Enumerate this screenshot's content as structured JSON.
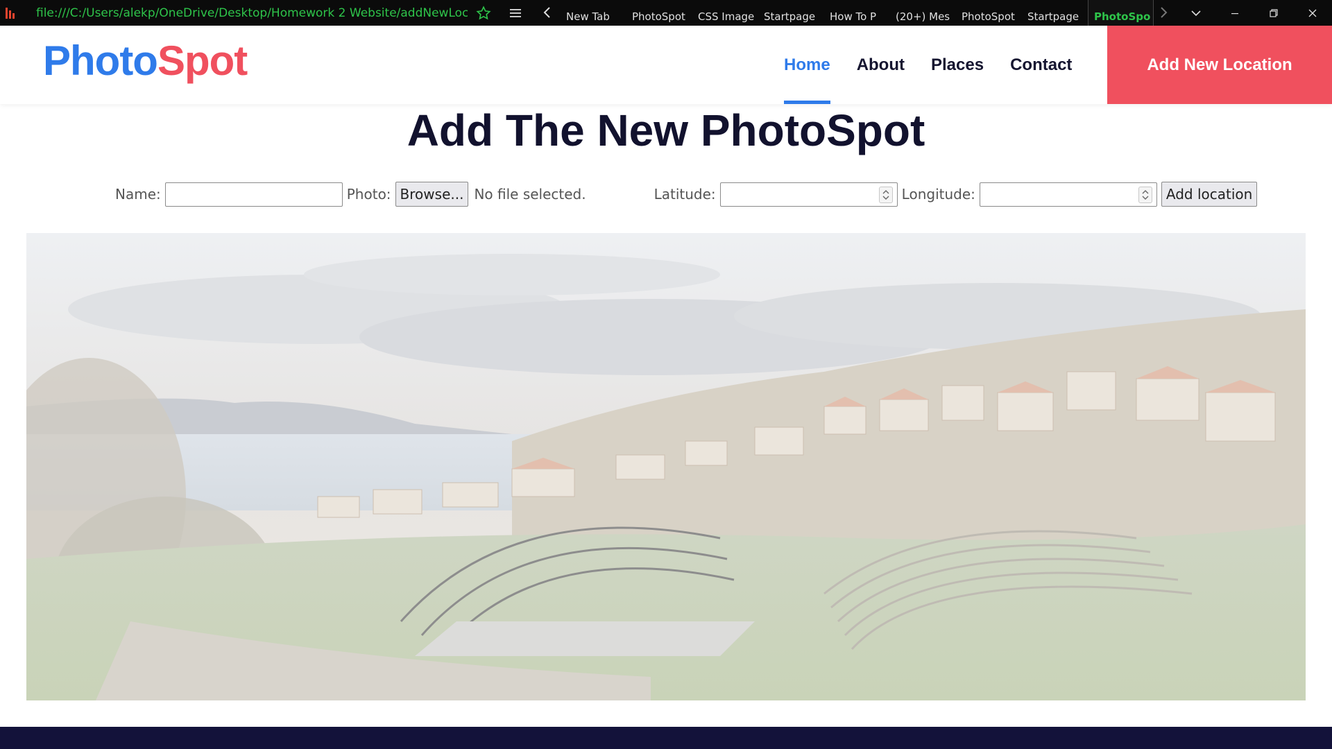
{
  "browser": {
    "url": "file:///C:/Users/alekp/OneDrive/Desktop/Homework 2 Website/addNewLocation.h",
    "tabs": [
      {
        "label": "New Tab"
      },
      {
        "label": "PhotoSpot"
      },
      {
        "label": "CSS Image"
      },
      {
        "label": "Startpage"
      },
      {
        "label": "How To P"
      },
      {
        "label": "(20+) Mes"
      },
      {
        "label": "PhotoSpot"
      },
      {
        "label": "Startpage"
      },
      {
        "label": "PhotoSpo"
      }
    ],
    "active_tab_index": 8,
    "accent_color": "#2ec44a"
  },
  "header": {
    "logo_part1": "Photo",
    "logo_part2": "Spot",
    "logo_colors": {
      "part1": "#2f7bea",
      "part2": "#f0505e"
    },
    "nav": [
      {
        "label": "Home",
        "active": true
      },
      {
        "label": "About",
        "active": false
      },
      {
        "label": "Places",
        "active": false
      },
      {
        "label": "Contact",
        "active": false
      }
    ],
    "cta_label": "Add New Location",
    "cta_color": "#f0505e"
  },
  "main": {
    "title": "Add The New PhotoSpot",
    "form": {
      "name_label": "Name:",
      "name_value": "",
      "photo_label": "Photo:",
      "browse_label": "Browse...",
      "file_status": "No file selected.",
      "latitude_label": "Latitude:",
      "latitude_value": "",
      "longitude_label": "Longitude:",
      "longitude_value": "",
      "submit_label": "Add location"
    }
  },
  "footer": {
    "color": "#13123a"
  }
}
